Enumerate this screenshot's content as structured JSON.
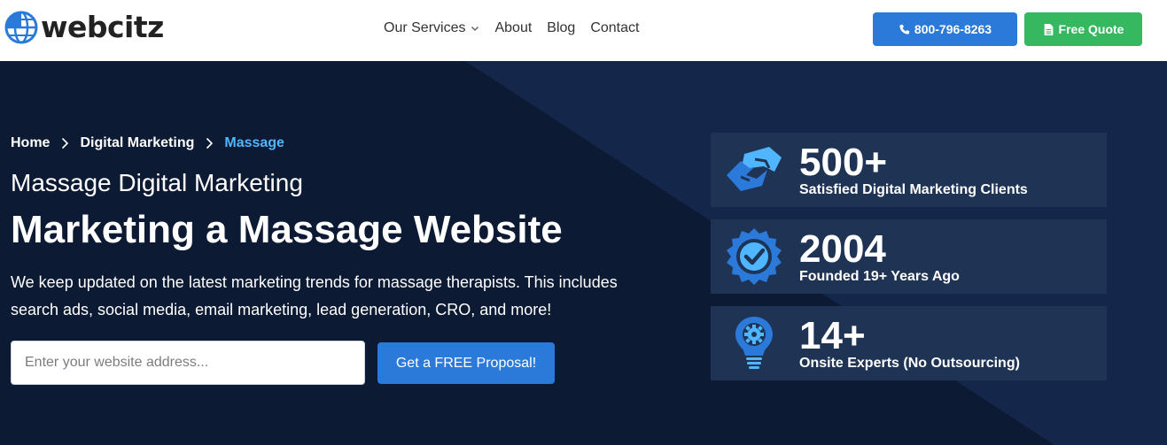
{
  "brand": {
    "name": "webcitz",
    "primary": "#2b7ad9",
    "accent_green": "#35b860",
    "hero_bg": "#0c1a33"
  },
  "nav": {
    "items": [
      {
        "label": "Our Services",
        "has_dropdown": true
      },
      {
        "label": "About"
      },
      {
        "label": "Blog"
      },
      {
        "label": "Contact"
      }
    ]
  },
  "header": {
    "phone_label": "800-796-8263",
    "quote_label": "Free Quote"
  },
  "breadcrumb": {
    "home": "Home",
    "parent": "Digital Marketing",
    "current": "Massage"
  },
  "hero": {
    "subtitle": "Massage Digital Marketing",
    "title": "Marketing a Massage Website",
    "description": "We keep updated on the latest marketing trends for massage therapists. This includes search ads, social media, email marketing, lead generation, CRO, and more!",
    "input_placeholder": "Enter your website address...",
    "input_value": "",
    "cta_label": "Get a FREE Proposal!"
  },
  "stats": [
    {
      "value": "500+",
      "label": "Satisfied Digital Marketing Clients",
      "icon": "handshake-icon"
    },
    {
      "value": "2004",
      "label": "Founded 19+ Years Ago",
      "icon": "badge-check-icon"
    },
    {
      "value": "14+",
      "label": "Onsite Experts (No Outsourcing)",
      "icon": "lightbulb-gear-icon"
    }
  ]
}
